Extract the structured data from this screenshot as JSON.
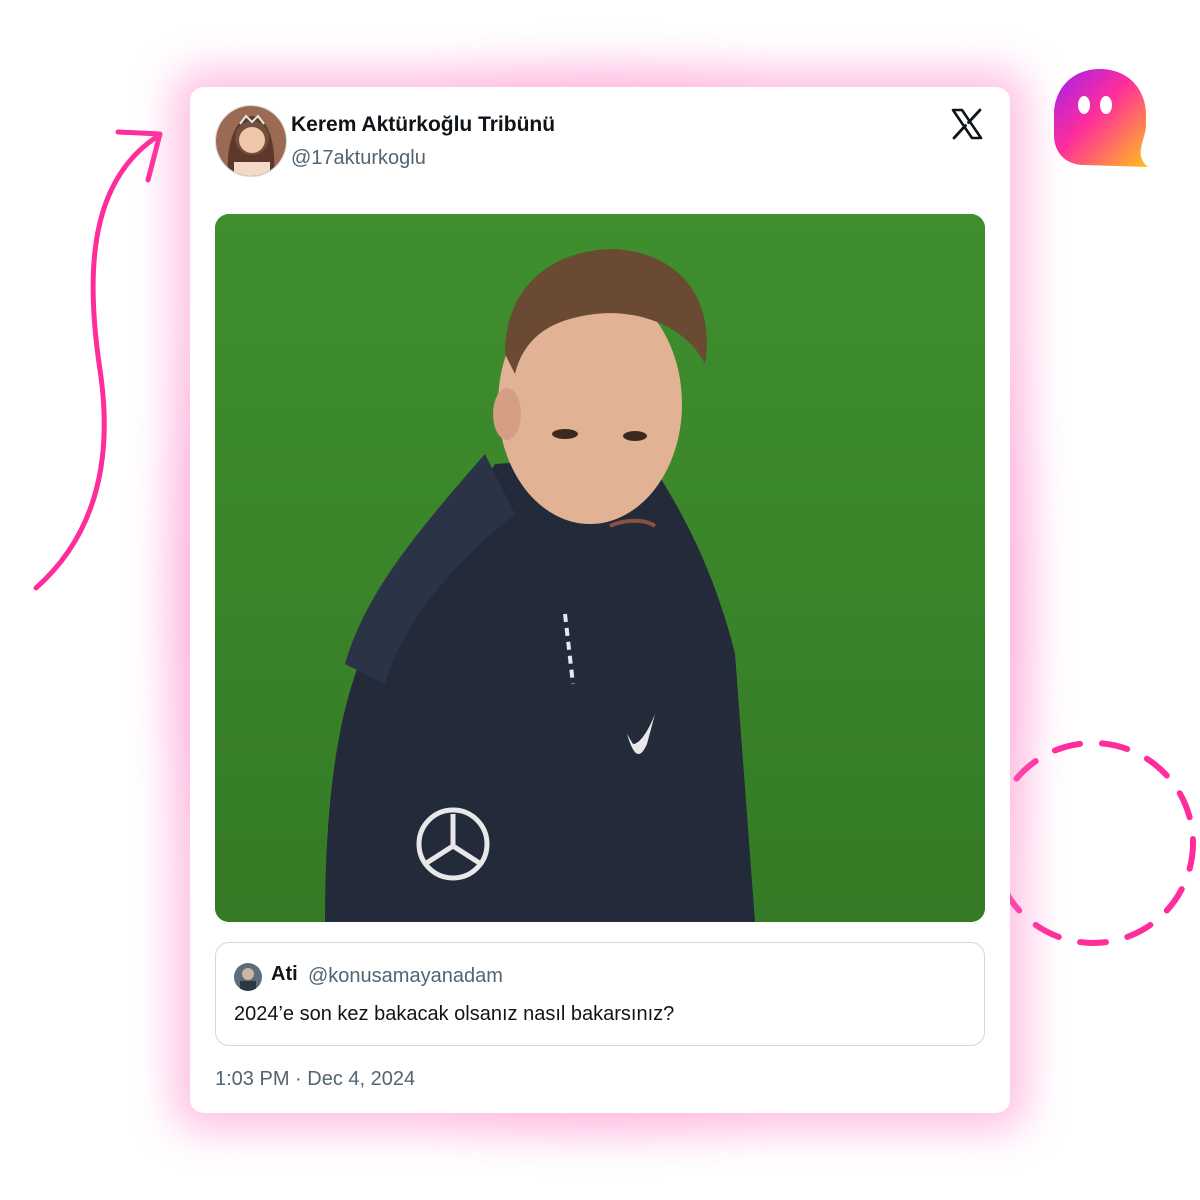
{
  "tweet": {
    "display_name": "Kerem Aktürkoğlu Tribünü",
    "handle": "@17akturkoglu",
    "timestamp": "1:03 PM · Dec 4, 2024"
  },
  "quote": {
    "name": "Ati",
    "handle": "@konusamayanadam",
    "text": "2024’e son kez bakacak olsanız nasıl bakarsınız?"
  },
  "colors": {
    "accent_pink": "#ff2d9b",
    "card_bg": "#ffffff",
    "text_primary": "#0f1419",
    "text_secondary": "#536471"
  },
  "icons": {
    "platform_logo": "x-logo",
    "brand": "ghost-logo"
  }
}
